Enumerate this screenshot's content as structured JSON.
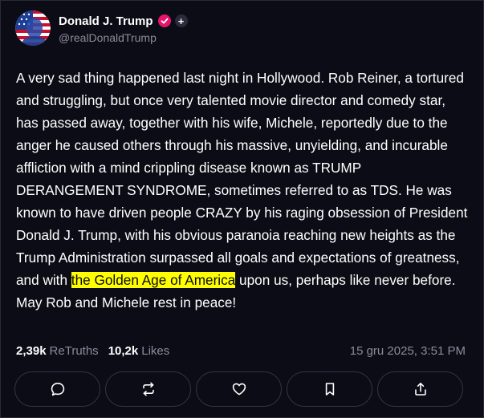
{
  "post": {
    "author": {
      "display_name": "Donald J. Trump",
      "handle": "@realDonaldTrump",
      "avatar_icon": "avatar-flag-portrait",
      "verified_icon": "verified-badge-icon",
      "plus_label": "+"
    },
    "text": {
      "before": "A very sad thing happened last night in Hollywood. Rob Reiner, a tortured and struggling, but once very talented movie director and comedy star, has passed away, together with his wife, Michele, reportedly due to the anger he caused others through his massive, unyielding, and incurable affliction with a mind crippling disease known as TRUMP DERANGEMENT SYNDROME, sometimes referred to as TDS. He was known to have driven people CRAZY by his raging obsession of President Donald J. Trump, with his obvious paranoia reaching new heights as the Trump Administration surpassed all goals and expectations of greatness, and with ",
      "highlight": "the Golden Age of America",
      "after": " upon us, perhaps like never before. May Rob and Michele rest in peace!"
    },
    "stats": {
      "retruths_count": "2,39k",
      "retruths_label": "ReTruths",
      "likes_count": "10,2k",
      "likes_label": "Likes",
      "timestamp": "15 gru 2025, 3:51 PM"
    },
    "actions": [
      {
        "name": "reply-button",
        "icon": "comment-icon"
      },
      {
        "name": "retruth-button",
        "icon": "repost-icon"
      },
      {
        "name": "like-button",
        "icon": "heart-icon"
      },
      {
        "name": "bookmark-button",
        "icon": "bookmark-icon"
      },
      {
        "name": "share-button",
        "icon": "share-icon"
      }
    ],
    "colors": {
      "background": "#0c0c16",
      "highlight": "#ffff00",
      "verified": "#e5156b",
      "muted_text": "#8b8b9c"
    }
  }
}
